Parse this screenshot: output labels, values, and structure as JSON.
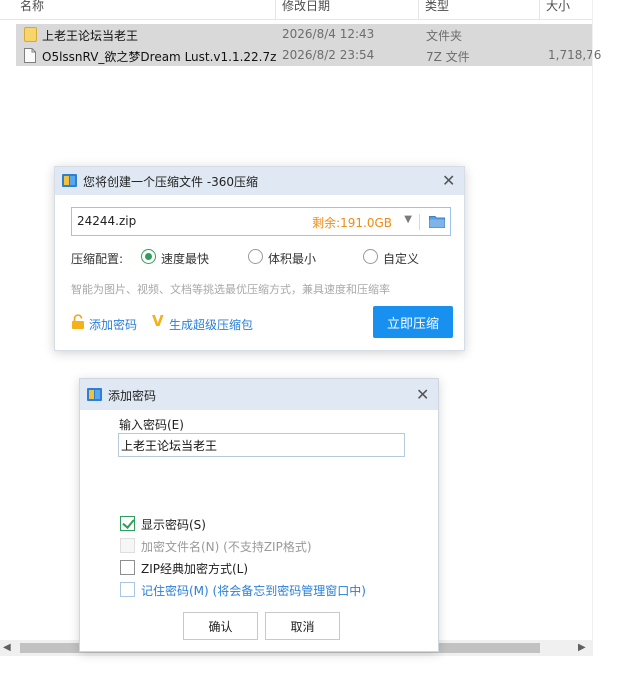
{
  "explorer": {
    "columns": [
      "名称",
      "修改日期",
      "类型",
      "大小"
    ],
    "files": [
      {
        "name": "上老王论坛当老王",
        "date": "2026/8/4 12:43",
        "type": "文件夹",
        "size": ""
      },
      {
        "name": "O5lssnRV_欲之梦Dream Lust.v1.1.22.7z",
        "date": "2026/8/2 23:54",
        "type": "7Z 文件",
        "size": "1,718,76"
      }
    ],
    "scroll_left": "◀",
    "scroll_right": "▶"
  },
  "compress_dialog": {
    "title": "您将创建一个压缩文件 -360压缩",
    "close": "✕",
    "archive_name": "24244.zip",
    "free_space": "剩余:191.0GB",
    "dropdown_arrow": "▼",
    "config_label": "压缩配置:",
    "options": [
      "速度最快",
      "体积最小",
      "自定义"
    ],
    "selected_option": "速度最快",
    "hint": "智能为图片、视频、文档等挑选最优压缩方式，兼具速度和压缩率",
    "add_password": "添加密码",
    "v_mark": "V",
    "super_package": "生成超级压缩包",
    "compress_now": "立即压缩",
    "colors": {
      "accent": "#1890ef",
      "free_space": "#ef8a14",
      "link": "#2a7fd8",
      "radio_selected": "#2f9e5d"
    }
  },
  "password_dialog": {
    "title": "添加密码",
    "close": "✕",
    "input_label": "输入密码(E)",
    "password_value": "上老王论坛当老王",
    "show_password": {
      "label": "显示密码(S)",
      "checked": true
    },
    "encrypt_filenames": {
      "label": "加密文件名(N) (不支持ZIP格式)",
      "checked": false,
      "disabled": true
    },
    "zip_classic": {
      "label": "ZIP经典加密方式(L)",
      "checked": false
    },
    "remember_password": {
      "label": "记住密码(M) (将会备忘到密码管理窗口中)",
      "checked": false
    },
    "ok": "确认",
    "cancel": "取消"
  }
}
